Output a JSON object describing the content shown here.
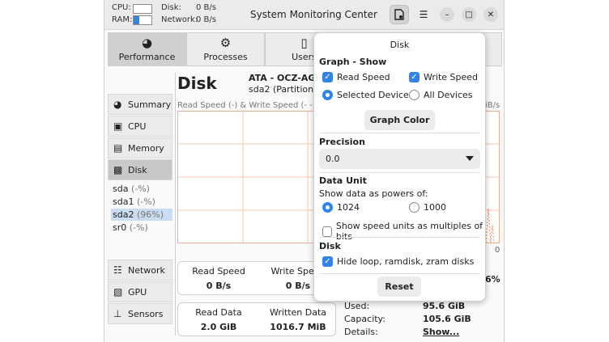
{
  "titlebar": {
    "cpu_label": "CPU:",
    "ram_label": "RAM:",
    "cpu_fill": 0,
    "ram_fill": 0.3,
    "disk_label": "Disk:",
    "disk_value": "0 B/s",
    "network_label": "Network:",
    "network_value": "0 B/s",
    "app_title": "System Monitoring Center",
    "accent": "#3584e4"
  },
  "tabs": [
    {
      "label": "Performance",
      "icon": "speedometer-icon"
    },
    {
      "label": "Processes",
      "icon": "gear-icon"
    },
    {
      "label": "Users",
      "icon": "mouse-icon"
    }
  ],
  "sidebar": {
    "items": [
      {
        "label": "Summary",
        "icon": "speedometer-icon"
      },
      {
        "label": "CPU",
        "icon": "chip-icon"
      },
      {
        "label": "Memory",
        "icon": "memory-icon"
      },
      {
        "label": "Disk",
        "icon": "disk-icon"
      },
      {
        "label": "Network",
        "icon": "globe-icon"
      },
      {
        "label": "GPU",
        "icon": "gpu-icon"
      },
      {
        "label": "Sensors",
        "icon": "thermometer-icon"
      }
    ],
    "devices": [
      {
        "name": "sda",
        "pct": "(-%)"
      },
      {
        "name": "sda1",
        "pct": "(-%)"
      },
      {
        "name": "sda2",
        "pct": "(96%)"
      },
      {
        "name": "sr0",
        "pct": "(-%)"
      }
    ]
  },
  "main": {
    "title": "Disk",
    "model": "ATA - OCZ-AGIL",
    "partition": "sda2 (Partition)",
    "graph_label": "Read Speed (-) & Write Speed (- -)",
    "graph_unit": "iB/s",
    "graph_zero": "0",
    "graph_color": "#f08c5a",
    "speed_card": {
      "read_label": "Read Speed",
      "read_value": "0 B/s",
      "write_label": "Write Speed",
      "write_value": "0 B/s"
    },
    "percent_value": "6%",
    "data_card": {
      "read_label": "Read Data",
      "read_value": "2.0 GiB",
      "write_label": "Written Data",
      "write_value": "1016.7 MiB"
    },
    "details": [
      {
        "key": "Used:",
        "value": "95.6 GiB"
      },
      {
        "key": "Capacity:",
        "value": "105.6 GiB"
      },
      {
        "key": "Details:",
        "value": "Show..."
      }
    ]
  },
  "popover": {
    "title": "Disk",
    "graph_show_title": "Graph - Show",
    "read_speed": {
      "label": "Read Speed",
      "checked": true
    },
    "write_speed": {
      "label": "Write Speed",
      "checked": true
    },
    "selected_device": {
      "label": "Selected Device",
      "selected": true
    },
    "all_devices": {
      "label": "All Devices",
      "selected": false
    },
    "graph_color_button": "Graph Color",
    "precision_title": "Precision",
    "precision_value": "0.0",
    "data_unit_title": "Data Unit",
    "powers_label": "Show data as powers of:",
    "power_1024": {
      "label": "1024",
      "selected": true
    },
    "power_1000": {
      "label": "1000",
      "selected": false
    },
    "bits_option": {
      "label": "Show speed units as multiples of bits",
      "checked": false
    },
    "disk_section_title": "Disk",
    "hide_loop": {
      "label": "Hide loop, ramdisk, zram disks",
      "checked": true
    },
    "reset_button": "Reset"
  }
}
